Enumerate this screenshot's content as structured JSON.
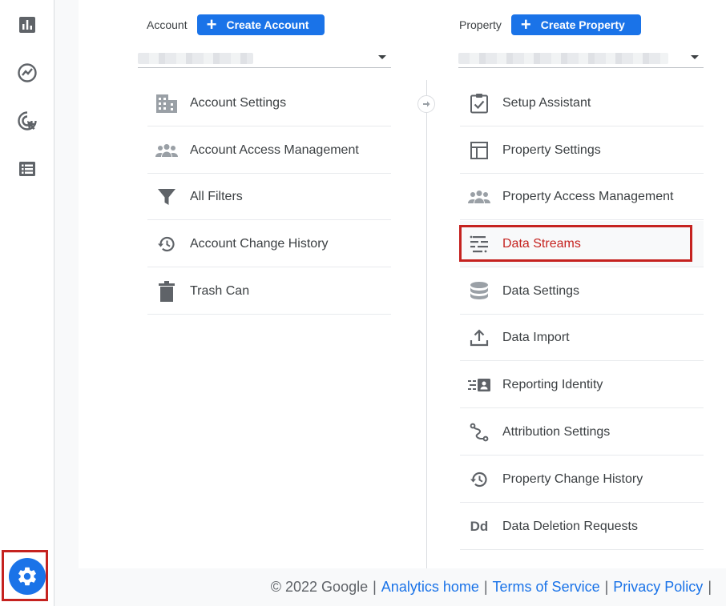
{
  "account": {
    "label": "Account",
    "create_label": "Create Account",
    "items": [
      {
        "label": "Account Settings",
        "icon": "building-icon"
      },
      {
        "label": "Account Access Management",
        "icon": "people-icon"
      },
      {
        "label": "All Filters",
        "icon": "filter-icon"
      },
      {
        "label": "Account Change History",
        "icon": "history-icon"
      },
      {
        "label": "Trash Can",
        "icon": "trash-icon"
      }
    ]
  },
  "property": {
    "label": "Property",
    "create_label": "Create Property",
    "items": [
      {
        "label": "Setup Assistant",
        "icon": "checklist-icon"
      },
      {
        "label": "Property Settings",
        "icon": "layout-icon"
      },
      {
        "label": "Property Access Management",
        "icon": "people-icon"
      },
      {
        "label": "Data Streams",
        "icon": "streams-icon",
        "highlighted": true
      },
      {
        "label": "Data Settings",
        "icon": "database-icon"
      },
      {
        "label": "Data Import",
        "icon": "upload-icon"
      },
      {
        "label": "Reporting Identity",
        "icon": "identity-icon"
      },
      {
        "label": "Attribution Settings",
        "icon": "attribution-icon"
      },
      {
        "label": "Property Change History",
        "icon": "history-icon"
      },
      {
        "label": "Data Deletion Requests",
        "icon": "dd-icon",
        "icon_text": "Dd"
      }
    ]
  },
  "footer": {
    "copyright": "© 2022 Google",
    "links": [
      "Analytics home",
      "Terms of Service",
      "Privacy Policy"
    ]
  },
  "colors": {
    "accent": "#1a73e8",
    "highlight": "#c5221f",
    "icon": "#5f6368"
  }
}
